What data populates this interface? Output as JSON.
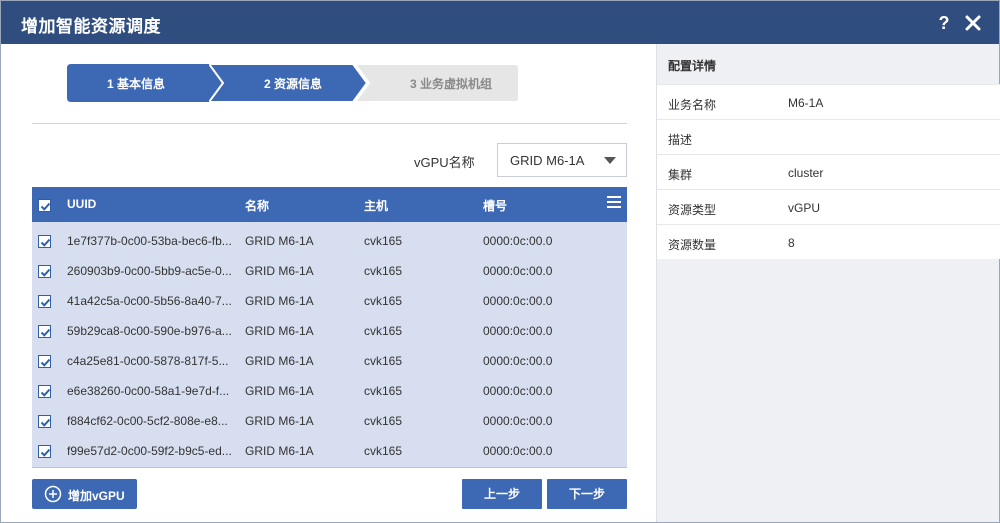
{
  "dialog": {
    "title": "增加智能资源调度",
    "help": "?"
  },
  "steps": [
    {
      "label": "1 基本信息",
      "state": "done"
    },
    {
      "label": "2 资源信息",
      "state": "active"
    },
    {
      "label": "3 业务虚拟机组",
      "state": "pending"
    }
  ],
  "vgpu_filter": {
    "label": "vGPU名称",
    "value": "GRID M6-1A"
  },
  "table": {
    "columns": {
      "uuid": "UUID",
      "name": "名称",
      "host": "主机",
      "slot": "槽号"
    },
    "rows": [
      {
        "uuid": "1e7f377b-0c00-53ba-bec6-fb...",
        "name": "GRID M6-1A",
        "host": "cvk165",
        "slot": "0000:0c:00.0",
        "checked": true
      },
      {
        "uuid": "260903b9-0c00-5bb9-ac5e-0...",
        "name": "GRID M6-1A",
        "host": "cvk165",
        "slot": "0000:0c:00.0",
        "checked": true
      },
      {
        "uuid": "41a42c5a-0c00-5b56-8a40-7...",
        "name": "GRID M6-1A",
        "host": "cvk165",
        "slot": "0000:0c:00.0",
        "checked": true
      },
      {
        "uuid": "59b29ca8-0c00-590e-b976-a...",
        "name": "GRID M6-1A",
        "host": "cvk165",
        "slot": "0000:0c:00.0",
        "checked": true
      },
      {
        "uuid": "c4a25e81-0c00-5878-817f-5...",
        "name": "GRID M6-1A",
        "host": "cvk165",
        "slot": "0000:0c:00.0",
        "checked": true
      },
      {
        "uuid": "e6e38260-0c00-58a1-9e7d-f...",
        "name": "GRID M6-1A",
        "host": "cvk165",
        "slot": "0000:0c:00.0",
        "checked": true
      },
      {
        "uuid": "f884cf62-0c00-5cf2-808e-e8...",
        "name": "GRID M6-1A",
        "host": "cvk165",
        "slot": "0000:0c:00.0",
        "checked": true
      },
      {
        "uuid": "f99e57d2-0c00-59f2-b9c5-ed...",
        "name": "GRID M6-1A",
        "host": "cvk165",
        "slot": "0000:0c:00.0",
        "checked": true
      }
    ]
  },
  "buttons": {
    "add_vgpu": "增加vGPU",
    "prev": "上一步",
    "next": "下一步"
  },
  "details": {
    "title": "配置详情",
    "items": [
      {
        "key": "业务名称",
        "value": "M6-1A"
      },
      {
        "key": "描述",
        "value": ""
      },
      {
        "key": "集群",
        "value": "cluster"
      },
      {
        "key": "资源类型",
        "value": "vGPU"
      },
      {
        "key": "资源数量",
        "value": "8"
      }
    ]
  },
  "colors": {
    "titlebar": "#2f4d7e",
    "accent": "#3d69b4",
    "table_body": "#d6deef",
    "step_pending": "#e6e6e6"
  }
}
